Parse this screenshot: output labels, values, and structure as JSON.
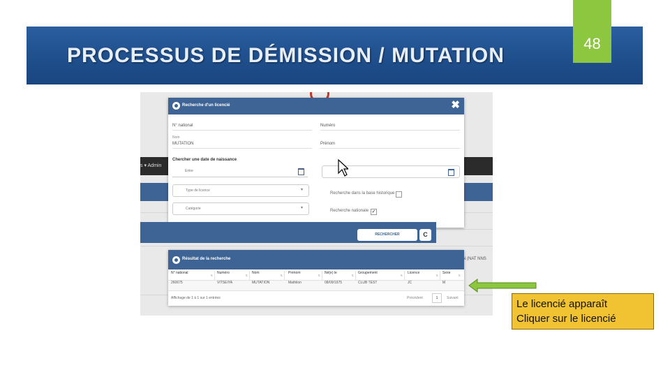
{
  "slide": {
    "title": "PROCESSUS DE DÉMISSION / MUTATION",
    "page_number": "48",
    "colors": {
      "band": "#1f4f8c",
      "page_box": "#8dc63f",
      "callout": "#f1c232",
      "arrow": "#8dc63f"
    }
  },
  "screenshot": {
    "background": {
      "nav_text": "s ▾  Admin",
      "side_text": "N (NAT NNS"
    },
    "search_modal": {
      "title": "Recherche d'un licencié",
      "close_label": "✖",
      "fields": {
        "national_number": {
          "label": "N° national",
          "value": ""
        },
        "number": {
          "label": "Numéro",
          "value": ""
        },
        "name": {
          "label": "Nom",
          "value": "MUTATION"
        },
        "first_name": {
          "label": "Prénom",
          "value": ""
        }
      },
      "birthdate_section": "Chercher une date de naissance",
      "date_from": "Entre",
      "date_to": "",
      "licence_type": "Type de licence",
      "category": "Catégorie",
      "historic_checkbox": {
        "label": "Recherche dans la base historique",
        "checked": false
      },
      "national_checkbox": {
        "label": "Recherche nationale",
        "checked": true
      },
      "search_button": "RECHERCHER",
      "reset_button": "C"
    },
    "results": {
      "title": "Résultat de la recherche",
      "columns": [
        "N° national",
        "Numéro",
        "Nom",
        "Prénom",
        "Né(e) le",
        "Groupement",
        "Licence",
        "Sexe"
      ],
      "rows": [
        [
          "260675",
          "VITSEIYA",
          "MUTATION",
          "Mathilon",
          "08/09/1975",
          "CLUB TEST",
          "JC",
          "M"
        ]
      ],
      "pager_info": "Affichage de 1 à 1 sur 1 entrées",
      "prev_label": "Précédent",
      "page": "1",
      "next_label": "Suivant"
    }
  },
  "callout": {
    "line1": "Le licencié apparaît",
    "line2": "Cliquer sur le licencié"
  }
}
